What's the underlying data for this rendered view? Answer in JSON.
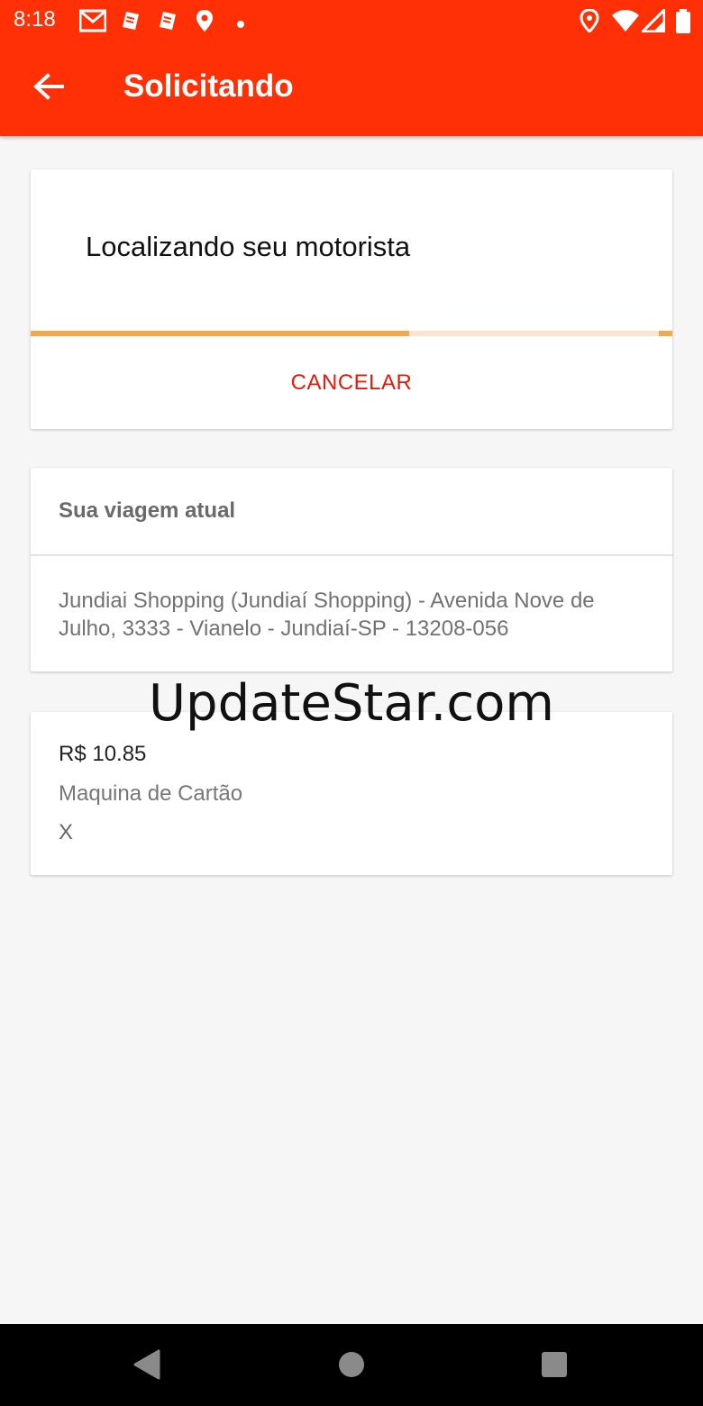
{
  "status_bar": {
    "time": "8:18",
    "left_icons": [
      "gmail-icon",
      "notification-icon",
      "notification-icon",
      "location-icon",
      "dot-icon"
    ],
    "right_icons": [
      "location-icon",
      "wifi-icon",
      "signal-icon",
      "battery-icon"
    ]
  },
  "toolbar": {
    "title": "Solicitando",
    "back_icon": "arrow-left-icon"
  },
  "search_card": {
    "message": "Localizando seu motorista",
    "progress": 0.59,
    "cancel_label": "CANCELAR"
  },
  "trip_card": {
    "header": "Sua viagem atual",
    "address": "Jundiai Shopping (Jundiaí Shopping) - Avenida Nove de Julho, 3333 - Vianelo - Jundiaí-SP - 13208-056"
  },
  "payment_card": {
    "price": "R$ 10.85",
    "method": "Maquina de Cartão",
    "extra": "X"
  },
  "watermark": "UpdateStar.com",
  "nav_bar": {
    "back_icon": "triangle-back-icon",
    "home_icon": "circle-home-icon",
    "recents_icon": "square-recents-icon"
  },
  "colors": {
    "appbar": "#ff2f06",
    "cancel": "#e8190a",
    "progress": "#f5a84a",
    "progress_track": "#fde4d1"
  }
}
